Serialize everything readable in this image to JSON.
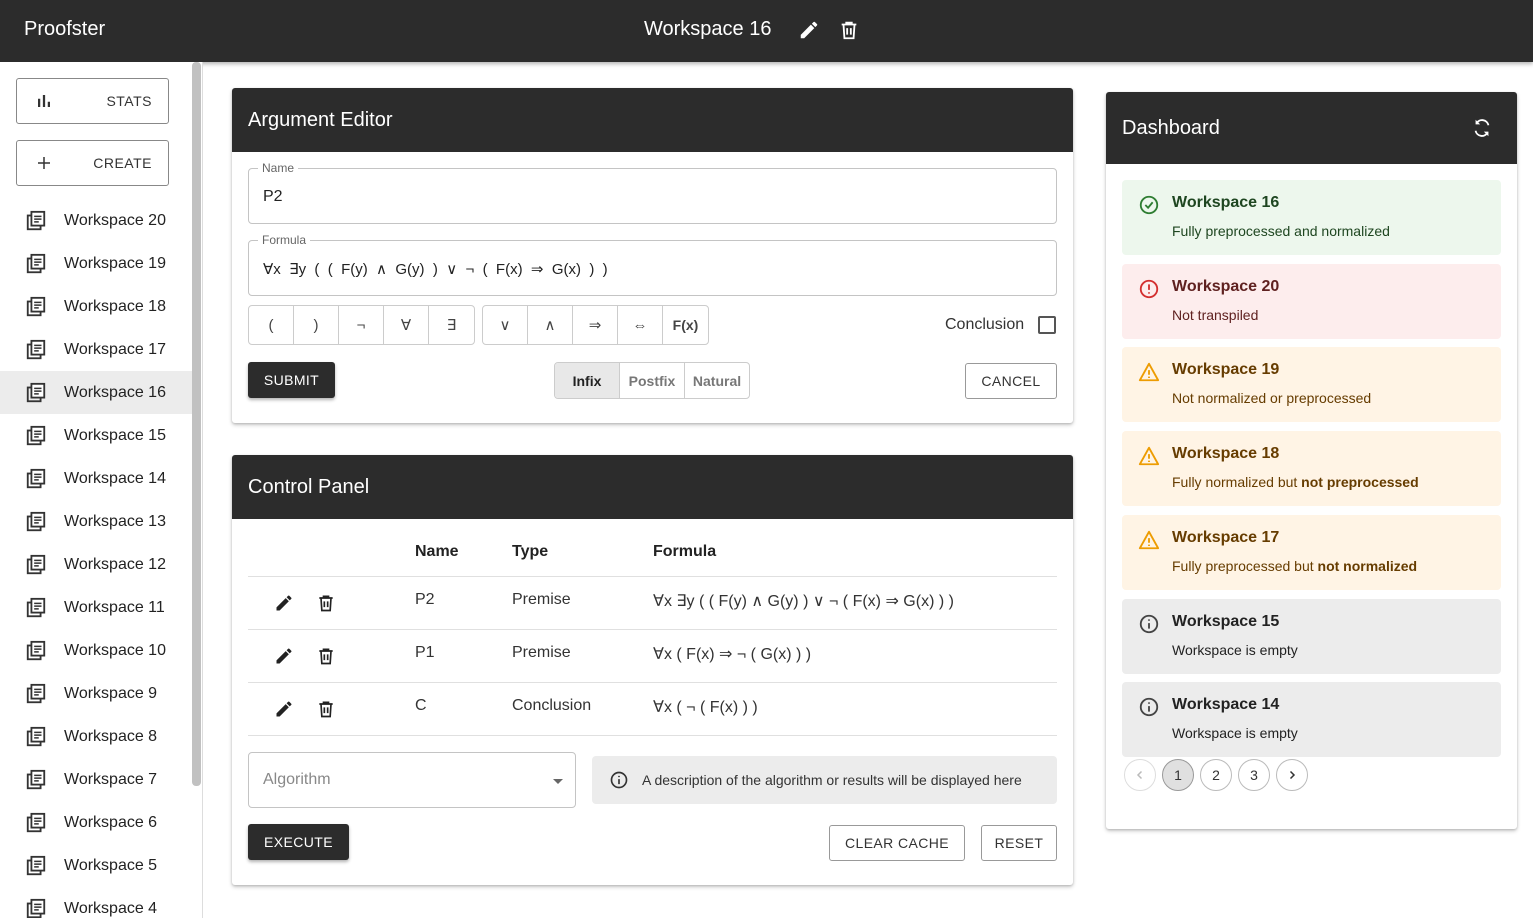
{
  "app": {
    "title": "Proofster"
  },
  "header": {
    "workspace_title": "Workspace 16",
    "edit_icon": "pencil-icon",
    "delete_icon": "trash-icon"
  },
  "sidebar": {
    "stats_label": "STATS",
    "create_label": "CREATE",
    "items": [
      {
        "label": "Workspace 20"
      },
      {
        "label": "Workspace 19"
      },
      {
        "label": "Workspace 18"
      },
      {
        "label": "Workspace 17"
      },
      {
        "label": "Workspace 16",
        "active": true
      },
      {
        "label": "Workspace 15"
      },
      {
        "label": "Workspace 14"
      },
      {
        "label": "Workspace 13"
      },
      {
        "label": "Workspace 12"
      },
      {
        "label": "Workspace 11"
      },
      {
        "label": "Workspace 10"
      },
      {
        "label": "Workspace 9"
      },
      {
        "label": "Workspace 8"
      },
      {
        "label": "Workspace 7"
      },
      {
        "label": "Workspace 6"
      },
      {
        "label": "Workspace 5"
      },
      {
        "label": "Workspace 4"
      }
    ]
  },
  "editor": {
    "title": "Argument Editor",
    "name_label": "Name",
    "name_value": "P2",
    "formula_label": "Formula",
    "formula_value": "∀x  ∃y  (  (  F(y)  ∧  G(y)  )  ∨  ¬  (  F(x)  ⇒  G(x)  )  )",
    "symbols_group1": [
      "(",
      ")",
      "¬",
      "∀",
      "∃"
    ],
    "symbols_group2": [
      "∨",
      "∧",
      "⇒",
      "⇔",
      "F(x)"
    ],
    "conclusion_label": "Conclusion",
    "conclusion_checked": false,
    "submit_label": "SUBMIT",
    "notation_options": [
      "Infix",
      "Postfix",
      "Natural"
    ],
    "notation_selected": "Infix",
    "cancel_label": "CANCEL"
  },
  "control_panel": {
    "title": "Control Panel",
    "columns": [
      "Name",
      "Type",
      "Formula"
    ],
    "rows": [
      {
        "name": "P2",
        "type": "Premise",
        "formula": "∀x ∃y ( ( F(y) ∧ G(y) ) ∨ ¬ ( F(x) ⇒ G(x) ) )"
      },
      {
        "name": "P1",
        "type": "Premise",
        "formula": "∀x ( F(x) ⇒ ¬ ( G(x) ) )"
      },
      {
        "name": "C",
        "type": "Conclusion",
        "formula": "∀x ( ¬ ( F(x) ) )"
      }
    ],
    "algorithm_placeholder": "Algorithm",
    "info_text": "A description of the algorithm or results will be displayed here",
    "execute_label": "EXECUTE",
    "clear_cache_label": "CLEAR CACHE",
    "reset_label": "RESET"
  },
  "dashboard": {
    "title": "Dashboard",
    "alerts": [
      {
        "severity": "success",
        "title": "Workspace 16",
        "desc": "Fully preprocessed and normalized",
        "desc_bold": ""
      },
      {
        "severity": "error",
        "title": "Workspace 20",
        "desc": "Not transpiled",
        "desc_bold": ""
      },
      {
        "severity": "warning",
        "title": "Workspace 19",
        "desc": "Not normalized or preprocessed",
        "desc_bold": ""
      },
      {
        "severity": "warning",
        "title": "Workspace 18",
        "desc": "Fully normalized but ",
        "desc_bold": "not preprocessed"
      },
      {
        "severity": "warning",
        "title": "Workspace 17",
        "desc": "Fully preprocessed but ",
        "desc_bold": "not normalized"
      },
      {
        "severity": "info",
        "title": "Workspace 15",
        "desc": "Workspace is empty",
        "desc_bold": ""
      },
      {
        "severity": "info",
        "title": "Workspace 14",
        "desc": "Workspace is empty",
        "desc_bold": ""
      }
    ],
    "pagination": {
      "pages": [
        "1",
        "2",
        "3"
      ],
      "current": "1"
    }
  },
  "colors": {
    "appbar": "#2c2c2c",
    "success": "#2e7d32",
    "error": "#d32f2f",
    "warning": "#ed9c02",
    "info": "#444444"
  }
}
